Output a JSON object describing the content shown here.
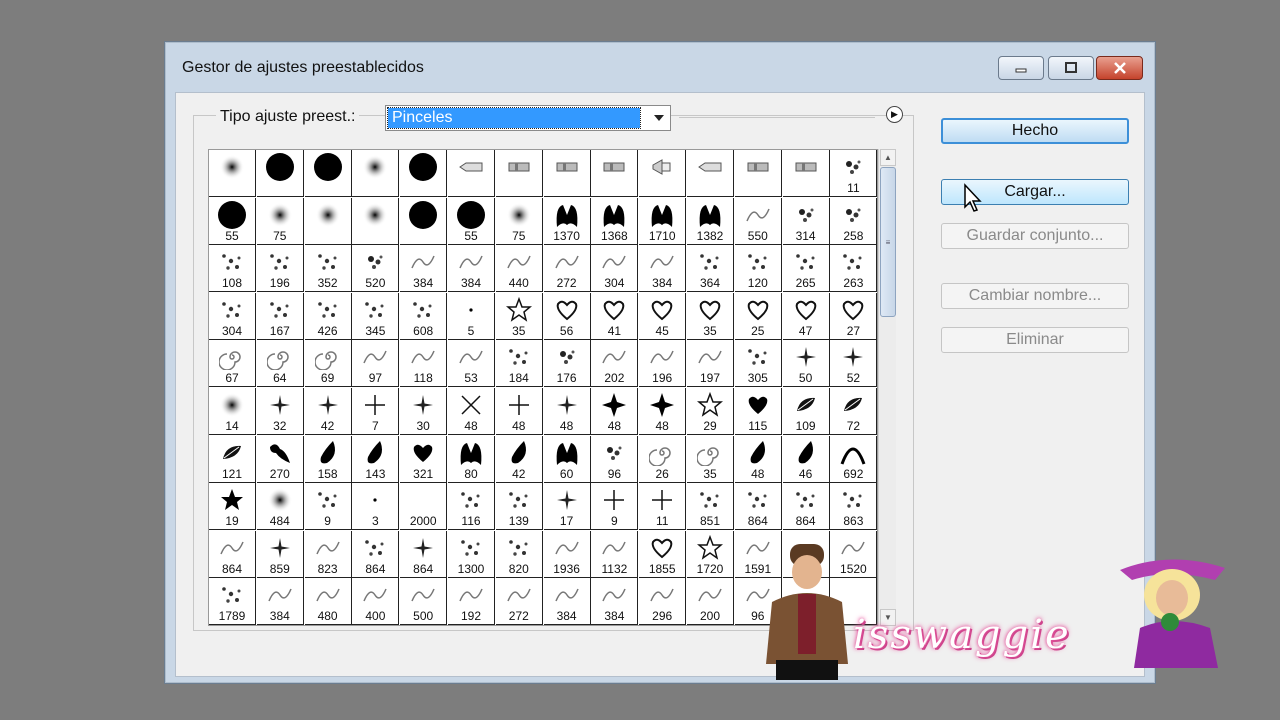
{
  "window": {
    "title": "Gestor de ajustes preestablecidos"
  },
  "preset": {
    "label": "Tipo ajuste preest.:",
    "selected": "Pinceles"
  },
  "buttons": {
    "done": "Hecho",
    "load": "Cargar...",
    "save_set": "Guardar conjunto...",
    "rename": "Cambiar nombre...",
    "delete": "Eliminar"
  },
  "brushes": [
    [
      {
        "icon": "soft-round",
        "size": ""
      },
      {
        "icon": "hard-round",
        "size": ""
      },
      {
        "icon": "hard-round",
        "size": ""
      },
      {
        "icon": "soft-round",
        "size": ""
      },
      {
        "icon": "hard-round",
        "size": ""
      },
      {
        "icon": "pencil",
        "size": ""
      },
      {
        "icon": "chalk",
        "size": ""
      },
      {
        "icon": "chalk",
        "size": ""
      },
      {
        "icon": "chalk",
        "size": ""
      },
      {
        "icon": "airbrush",
        "size": ""
      },
      {
        "icon": "pencil",
        "size": ""
      },
      {
        "icon": "chalk",
        "size": ""
      },
      {
        "icon": "chalk",
        "size": ""
      },
      {
        "icon": "splatter",
        "size": "11"
      }
    ],
    [
      {
        "icon": "hard-round",
        "size": "55"
      },
      {
        "icon": "soft-round",
        "size": "75"
      },
      {
        "icon": "soft-round",
        "size": ""
      },
      {
        "icon": "soft-round",
        "size": ""
      },
      {
        "icon": "hard-round",
        "size": ""
      },
      {
        "icon": "hard-round",
        "size": "55"
      },
      {
        "icon": "soft-round",
        "size": "75"
      },
      {
        "icon": "leaf",
        "size": "1370"
      },
      {
        "icon": "leaf",
        "size": "1368"
      },
      {
        "icon": "leaf",
        "size": "1710"
      },
      {
        "icon": "leaf",
        "size": "1382"
      },
      {
        "icon": "stroke",
        "size": "550"
      },
      {
        "icon": "splatter",
        "size": "314"
      },
      {
        "icon": "splatter",
        "size": "258"
      }
    ],
    [
      {
        "icon": "dots",
        "size": "108"
      },
      {
        "icon": "dots",
        "size": "196"
      },
      {
        "icon": "dots",
        "size": "352"
      },
      {
        "icon": "splatter",
        "size": "520"
      },
      {
        "icon": "stroke",
        "size": "384"
      },
      {
        "icon": "stroke",
        "size": "384"
      },
      {
        "icon": "stroke",
        "size": "440"
      },
      {
        "icon": "stroke",
        "size": "272"
      },
      {
        "icon": "stroke",
        "size": "304"
      },
      {
        "icon": "stroke",
        "size": "384"
      },
      {
        "icon": "dots",
        "size": "364"
      },
      {
        "icon": "dots",
        "size": "120"
      },
      {
        "icon": "dots",
        "size": "265"
      },
      {
        "icon": "dots",
        "size": "263"
      }
    ],
    [
      {
        "icon": "dots",
        "size": "304"
      },
      {
        "icon": "dots",
        "size": "167"
      },
      {
        "icon": "dots",
        "size": "426"
      },
      {
        "icon": "dots",
        "size": "345"
      },
      {
        "icon": "dots",
        "size": "608"
      },
      {
        "icon": "dot",
        "size": "5"
      },
      {
        "icon": "star-outline",
        "size": "35"
      },
      {
        "icon": "heart",
        "size": "56"
      },
      {
        "icon": "heart",
        "size": "41"
      },
      {
        "icon": "heart",
        "size": "45"
      },
      {
        "icon": "heart",
        "size": "35"
      },
      {
        "icon": "heart",
        "size": "25"
      },
      {
        "icon": "heart",
        "size": "47"
      },
      {
        "icon": "heart",
        "size": "27"
      }
    ],
    [
      {
        "icon": "swirl",
        "size": "67"
      },
      {
        "icon": "swirl",
        "size": "64"
      },
      {
        "icon": "swirl",
        "size": "69"
      },
      {
        "icon": "stroke",
        "size": "97"
      },
      {
        "icon": "stroke",
        "size": "118"
      },
      {
        "icon": "stroke",
        "size": "53"
      },
      {
        "icon": "dots",
        "size": "184"
      },
      {
        "icon": "splatter",
        "size": "176"
      },
      {
        "icon": "stroke",
        "size": "202"
      },
      {
        "icon": "stroke",
        "size": "196"
      },
      {
        "icon": "stroke",
        "size": "197"
      },
      {
        "icon": "dots",
        "size": "305"
      },
      {
        "icon": "sparkle",
        "size": "50"
      },
      {
        "icon": "sparkle",
        "size": "52"
      }
    ],
    [
      {
        "icon": "soft-round",
        "size": "14"
      },
      {
        "icon": "sparkle",
        "size": "32"
      },
      {
        "icon": "sparkle",
        "size": "42"
      },
      {
        "icon": "cross",
        "size": "7"
      },
      {
        "icon": "sparkle",
        "size": "30"
      },
      {
        "icon": "x-mark",
        "size": "48"
      },
      {
        "icon": "cross",
        "size": "48"
      },
      {
        "icon": "sparkle",
        "size": "48"
      },
      {
        "icon": "star4",
        "size": "48"
      },
      {
        "icon": "star4",
        "size": "48"
      },
      {
        "icon": "star-outline",
        "size": "29"
      },
      {
        "icon": "heart-fill",
        "size": "115"
      },
      {
        "icon": "feather",
        "size": "109"
      },
      {
        "icon": "feather",
        "size": "72"
      }
    ],
    [
      {
        "icon": "feather",
        "size": "121"
      },
      {
        "icon": "bird",
        "size": "270"
      },
      {
        "icon": "drop",
        "size": "158"
      },
      {
        "icon": "drop",
        "size": "143"
      },
      {
        "icon": "heart-fill",
        "size": "321"
      },
      {
        "icon": "leaf",
        "size": "80"
      },
      {
        "icon": "drop",
        "size": "42"
      },
      {
        "icon": "leaf",
        "size": "60"
      },
      {
        "icon": "splatter",
        "size": "96"
      },
      {
        "icon": "swirl",
        "size": "26"
      },
      {
        "icon": "swirl",
        "size": "35"
      },
      {
        "icon": "drop",
        "size": "48"
      },
      {
        "icon": "drop",
        "size": "46"
      },
      {
        "icon": "arch",
        "size": "692"
      }
    ],
    [
      {
        "icon": "star-fill",
        "size": "19"
      },
      {
        "icon": "soft-round",
        "size": "484"
      },
      {
        "icon": "dots",
        "size": "9"
      },
      {
        "icon": "dot",
        "size": "3"
      },
      {
        "icon": "blank",
        "size": "2000"
      },
      {
        "icon": "dots",
        "size": "116"
      },
      {
        "icon": "dots",
        "size": "139"
      },
      {
        "icon": "sparkle",
        "size": "17"
      },
      {
        "icon": "cross",
        "size": "9"
      },
      {
        "icon": "cross",
        "size": "11"
      },
      {
        "icon": "dots",
        "size": "851"
      },
      {
        "icon": "dots",
        "size": "864"
      },
      {
        "icon": "dots",
        "size": "864"
      },
      {
        "icon": "dots",
        "size": "863"
      }
    ],
    [
      {
        "icon": "stroke",
        "size": "864"
      },
      {
        "icon": "sparkle",
        "size": "859"
      },
      {
        "icon": "stroke",
        "size": "823"
      },
      {
        "icon": "dots",
        "size": "864"
      },
      {
        "icon": "sparkle",
        "size": "864"
      },
      {
        "icon": "dots",
        "size": "1300"
      },
      {
        "icon": "dots",
        "size": "820"
      },
      {
        "icon": "stroke",
        "size": "1936"
      },
      {
        "icon": "stroke",
        "size": "1132"
      },
      {
        "icon": "heart",
        "size": "1855"
      },
      {
        "icon": "star-outline",
        "size": "1720"
      },
      {
        "icon": "stroke",
        "size": "1591"
      },
      {
        "icon": "blank",
        "size": ""
      },
      {
        "icon": "stroke",
        "size": "1520"
      }
    ],
    [
      {
        "icon": "dots",
        "size": "1789"
      },
      {
        "icon": "stroke",
        "size": "384"
      },
      {
        "icon": "stroke",
        "size": "480"
      },
      {
        "icon": "stroke",
        "size": "400"
      },
      {
        "icon": "stroke",
        "size": "500"
      },
      {
        "icon": "stroke",
        "size": "192"
      },
      {
        "icon": "stroke",
        "size": "272"
      },
      {
        "icon": "stroke",
        "size": "384"
      },
      {
        "icon": "stroke",
        "size": "384"
      },
      {
        "icon": "stroke",
        "size": "296"
      },
      {
        "icon": "stroke",
        "size": "200"
      },
      {
        "icon": "stroke",
        "size": "96"
      },
      {
        "icon": "blank",
        "size": ""
      },
      {
        "icon": "blank",
        "size": ""
      }
    ]
  ],
  "watermark": {
    "text": "isswaggie"
  },
  "colors": {
    "accent": "#3399ff",
    "window_frame": "#c9d7e6",
    "close": "#c5432c"
  }
}
